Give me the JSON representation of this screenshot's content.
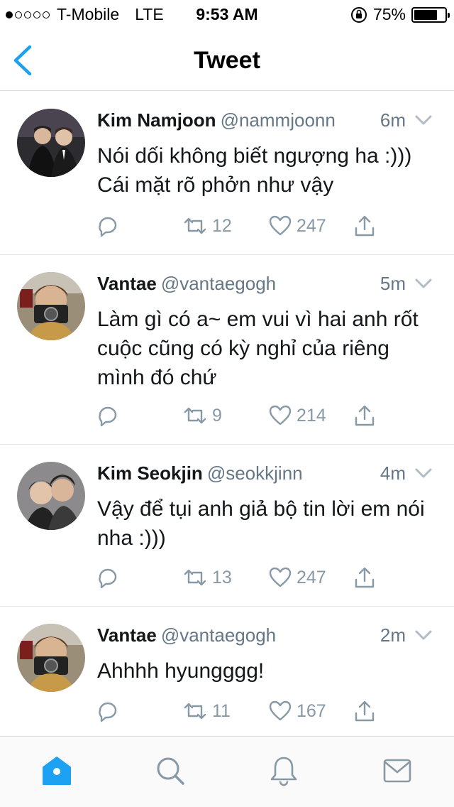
{
  "status_bar": {
    "carrier": "T-Mobile",
    "network": "LTE",
    "time": "9:53 AM",
    "battery": "75%",
    "battery_level": 0.75,
    "signal_bars_filled": 1
  },
  "nav": {
    "title": "Tweet"
  },
  "colors": {
    "accent": "#1da1f2",
    "gray": "#8899a6",
    "text": "#14171a"
  },
  "tweets": [
    {
      "name": "Kim Namjoon",
      "handle": "@nammjoonn",
      "time": "6m",
      "text": "Nói dối không biết ngượng ha :))) Cái mặt rõ phởn như vậy",
      "retweets": "12",
      "likes": "247"
    },
    {
      "name": "Vantae",
      "handle": "@vantaegogh",
      "time": "5m",
      "text": "Làm gì có a~ em vui vì hai anh rốt cuộc cũng có kỳ nghỉ của riêng mình đó chứ",
      "retweets": "9",
      "likes": "214"
    },
    {
      "name": "Kim Seokjin",
      "handle": "@seokkjinn",
      "time": "4m",
      "text": "Vậy để tụi anh giả bộ tin lời em nói nha :)))",
      "retweets": "13",
      "likes": "247"
    },
    {
      "name": "Vantae",
      "handle": "@vantaegogh",
      "time": "2m",
      "text": "Ahhhh hyungggg!",
      "retweets": "11",
      "likes": "167"
    }
  ],
  "tab_bar": {
    "active": "home",
    "tabs": [
      "home-icon",
      "search-icon",
      "notifications-icon",
      "messages-icon"
    ]
  }
}
